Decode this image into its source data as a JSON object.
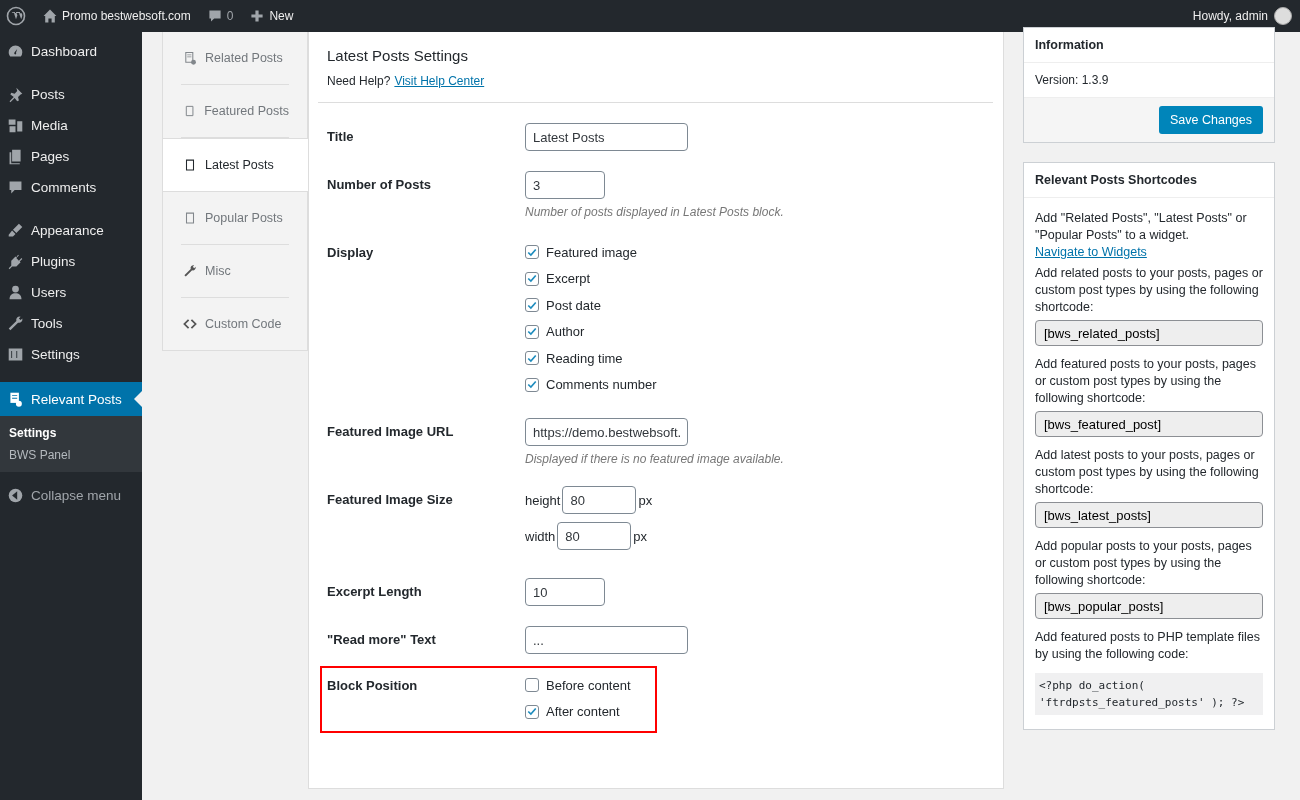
{
  "admin_bar": {
    "site": "Promo bestwebsoft.com",
    "comments": "0",
    "new": "New",
    "greeting": "Howdy, admin"
  },
  "sidebar": {
    "groups": [
      [
        {
          "label": "Dashboard",
          "selected": false
        }
      ],
      [
        {
          "label": "Posts",
          "selected": false
        },
        {
          "label": "Media",
          "selected": false
        },
        {
          "label": "Pages",
          "selected": false
        },
        {
          "label": "Comments",
          "selected": false
        }
      ],
      [
        {
          "label": "Appearance",
          "selected": false
        },
        {
          "label": "Plugins",
          "selected": false
        },
        {
          "label": "Users",
          "selected": false
        },
        {
          "label": "Tools",
          "selected": false
        },
        {
          "label": "Settings",
          "selected": false
        }
      ],
      [
        {
          "label": "Relevant Posts",
          "selected": true
        }
      ]
    ],
    "submenu": [
      {
        "label": "Settings",
        "selected": true
      },
      {
        "label": "BWS Panel",
        "selected": false
      }
    ],
    "collapse": "Collapse menu"
  },
  "tabs": [
    {
      "label": "Related Posts",
      "selected": false
    },
    {
      "label": "Featured Posts",
      "selected": false
    },
    {
      "label": "Latest Posts",
      "selected": true
    },
    {
      "label": "Popular Posts",
      "selected": false
    },
    {
      "label": "Misc",
      "selected": false
    },
    {
      "label": "Custom Code",
      "selected": false
    }
  ],
  "settings": {
    "title": "Latest Posts Settings",
    "help_prefix": "Need Help?",
    "help_link": "Visit Help Center",
    "rows": [
      {
        "kind": "text",
        "label": "Title",
        "value": "Latest Posts"
      },
      {
        "kind": "number",
        "label": "Number of Posts",
        "value": "3",
        "hint": "Number of posts displayed in Latest Posts block."
      },
      {
        "kind": "checks",
        "label": "Display",
        "options": [
          {
            "label": "Featured image",
            "checked": true
          },
          {
            "label": "Excerpt",
            "checked": true
          },
          {
            "label": "Post date",
            "checked": true
          },
          {
            "label": "Author",
            "checked": true
          },
          {
            "label": "Reading time",
            "checked": true
          },
          {
            "label": "Comments number",
            "checked": true
          }
        ]
      },
      {
        "kind": "text",
        "label": "Featured Image URL",
        "value": "https://demo.bestwebsoft.",
        "hint": "Displayed if there is no featured image available."
      },
      {
        "kind": "dimensions",
        "label": "Featured Image Size",
        "fields": [
          {
            "label": "height",
            "value": "80",
            "unit": "px"
          },
          {
            "label": "width",
            "value": "80",
            "unit": "px"
          }
        ]
      },
      {
        "kind": "number",
        "label": "Excerpt Length",
        "value": "10"
      },
      {
        "kind": "text",
        "label": "\"Read more\" Text",
        "value": "..."
      },
      {
        "kind": "checks",
        "label": "Block Position",
        "highlighted": true,
        "options": [
          {
            "label": "Before content",
            "checked": false
          },
          {
            "label": "After content",
            "checked": true
          }
        ]
      }
    ]
  },
  "info": {
    "title": "Information",
    "version": "Version: 1.3.9",
    "save": "Save Changes"
  },
  "shortcodes": {
    "title": "Relevant Posts Shortcodes",
    "intro": "Add \"Related Posts\", \"Latest Posts\" or \"Popular Posts\" to a widget.",
    "intro_link": "Navigate to Widgets",
    "items": [
      {
        "text": "Add related posts to your posts, pages or custom post types by using the following shortcode:",
        "code": "[bws_related_posts]"
      },
      {
        "text": "Add featured posts to your posts, pages or custom post types by using the following shortcode:",
        "code": "[bws_featured_post]"
      },
      {
        "text": "Add latest posts to your posts, pages or custom post types by using the following shortcode:",
        "code": "[bws_latest_posts]"
      },
      {
        "text": "Add popular posts to your posts, pages or custom post types by using the following shortcode:",
        "code": "[bws_popular_posts]"
      }
    ],
    "php_text": "Add featured posts to PHP template files by using the following code:",
    "php_code": "<?php do_action( 'ftrdpsts_featured_posts' ); ?>"
  }
}
